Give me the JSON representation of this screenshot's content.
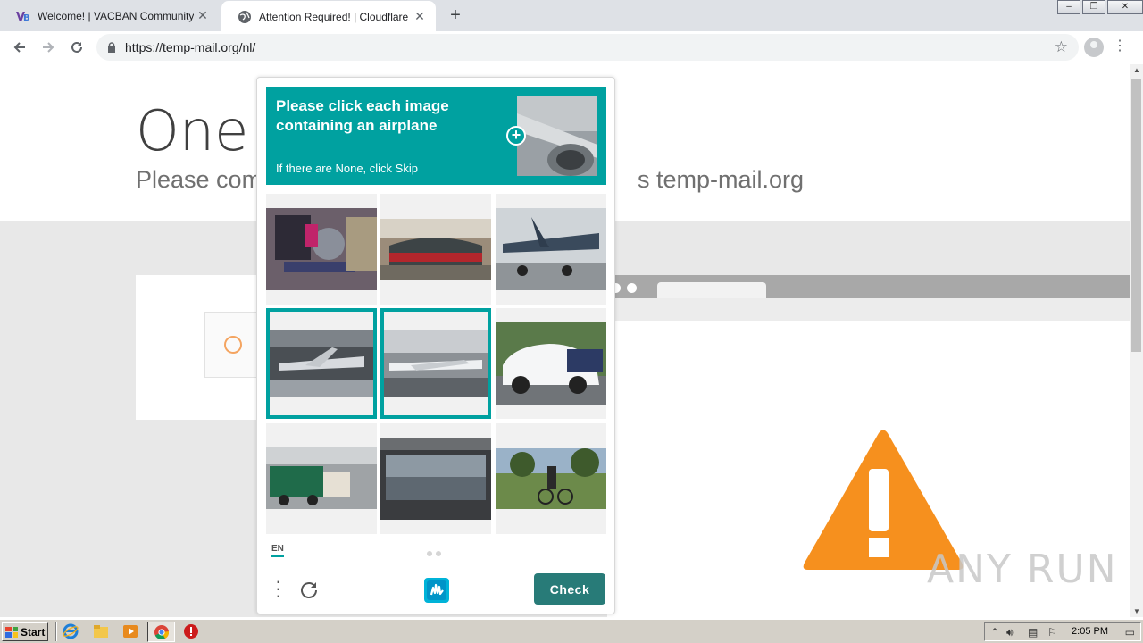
{
  "browser": {
    "tabs": [
      {
        "title": "Welcome! | VACBAN Community",
        "favicon": "vacban-icon",
        "active": false
      },
      {
        "title": "Attention Required! | Cloudflare",
        "favicon": "globe-icon",
        "active": true
      }
    ],
    "new_tab": "+",
    "url": "https://temp-mail.org/nl/",
    "window_controls": {
      "minimize": "–",
      "restore": "❐",
      "close": "✕"
    }
  },
  "page": {
    "heading": "One m",
    "subheading_left": "Please com",
    "subheading_right": "s temp-mail.org",
    "accent_color": "#f6901e"
  },
  "captcha": {
    "prompt": "Please click each image containing an airplane",
    "skip_hint": "If there are None, click Skip",
    "tiles": [
      {
        "subject": "engine parts",
        "selected": false
      },
      {
        "subject": "train at station",
        "selected": false
      },
      {
        "subject": "propeller airplane",
        "selected": false
      },
      {
        "subject": "airplane in hangar",
        "selected": true
      },
      {
        "subject": "airliner on runway",
        "selected": true
      },
      {
        "subject": "white car",
        "selected": false
      },
      {
        "subject": "truck on street",
        "selected": false
      },
      {
        "subject": "train window",
        "selected": false
      },
      {
        "subject": "cyclist in park",
        "selected": false
      }
    ],
    "language": "EN",
    "check_label": "Check",
    "brand_color": "#00a1a0",
    "button_color": "#287b78"
  },
  "watermark": "ANY RUN",
  "taskbar": {
    "start_label": "Start",
    "clock": "2:05 PM"
  }
}
